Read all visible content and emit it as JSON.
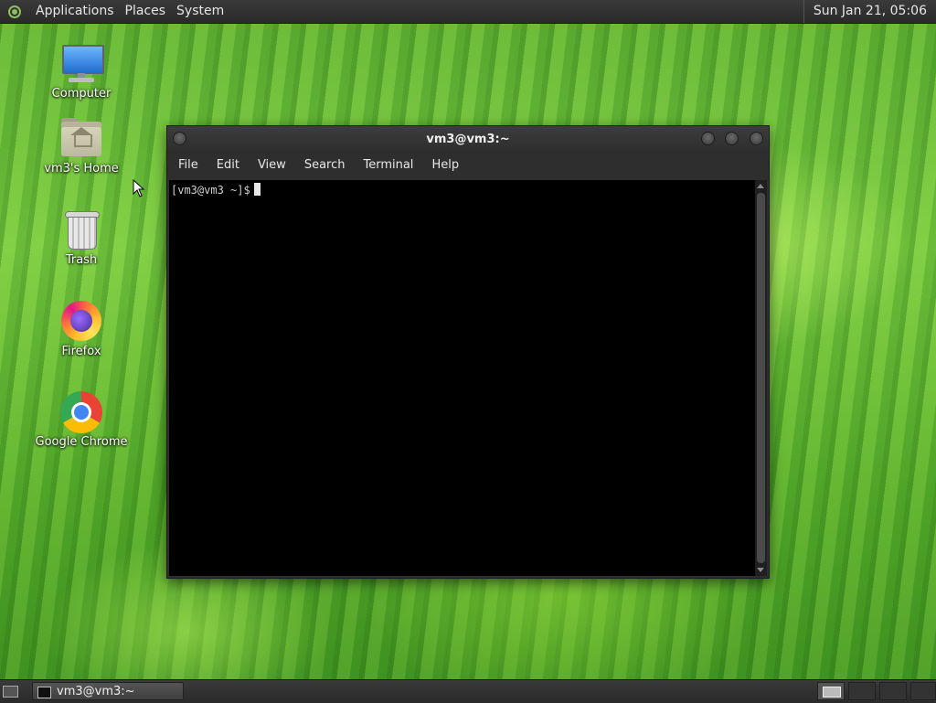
{
  "top_panel": {
    "menus": [
      "Applications",
      "Places",
      "System"
    ],
    "clock": "Sun Jan 21, 05:06"
  },
  "desktop": {
    "icons": [
      {
        "label": "Computer",
        "icon": "computer-icon"
      },
      {
        "label": "vm3's Home",
        "icon": "home-folder-icon"
      },
      {
        "label": "Trash",
        "icon": "trash-icon"
      },
      {
        "label": "Firefox",
        "icon": "firefox-icon"
      },
      {
        "label": "Google Chrome",
        "icon": "chrome-icon"
      }
    ]
  },
  "terminal": {
    "title": "vm3@vm3:~",
    "menu": [
      "File",
      "Edit",
      "View",
      "Search",
      "Terminal",
      "Help"
    ],
    "prompt": "[vm3@vm3 ~]$"
  },
  "bottom_panel": {
    "task_label": "vm3@vm3:~"
  },
  "colors": {
    "panel": "#2e2e2e",
    "terminal_bg": "#000000",
    "wallpaper_green": "#6cbf3c"
  }
}
